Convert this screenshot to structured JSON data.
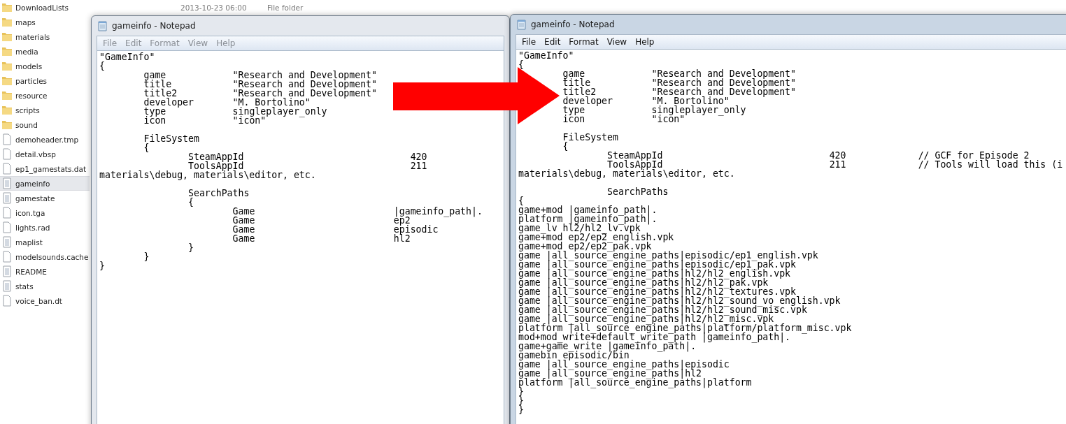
{
  "explorer": {
    "items": [
      {
        "name": "DownloadLists",
        "kind": "folder",
        "selected": false,
        "date": "2013-10-23 06:00",
        "type": "File folder"
      },
      {
        "name": "maps",
        "kind": "folder",
        "selected": false
      },
      {
        "name": "materials",
        "kind": "folder",
        "selected": false
      },
      {
        "name": "media",
        "kind": "folder",
        "selected": false
      },
      {
        "name": "models",
        "kind": "folder",
        "selected": false
      },
      {
        "name": "particles",
        "kind": "folder",
        "selected": false
      },
      {
        "name": "resource",
        "kind": "folder",
        "selected": false
      },
      {
        "name": "scripts",
        "kind": "folder",
        "selected": false
      },
      {
        "name": "sound",
        "kind": "folder",
        "selected": false
      },
      {
        "name": "demoheader.tmp",
        "kind": "file",
        "selected": false
      },
      {
        "name": "detail.vbsp",
        "kind": "file",
        "selected": false
      },
      {
        "name": "ep1_gamestats.dat",
        "kind": "file",
        "selected": false
      },
      {
        "name": "gameinfo",
        "kind": "text",
        "selected": true
      },
      {
        "name": "gamestate",
        "kind": "text",
        "selected": false
      },
      {
        "name": "icon.tga",
        "kind": "file",
        "selected": false
      },
      {
        "name": "lights.rad",
        "kind": "file",
        "selected": false
      },
      {
        "name": "maplist",
        "kind": "text",
        "selected": false
      },
      {
        "name": "modelsounds.cache",
        "kind": "file",
        "selected": false
      },
      {
        "name": "README",
        "kind": "text",
        "selected": false
      },
      {
        "name": "stats",
        "kind": "text",
        "selected": false
      },
      {
        "name": "voice_ban.dt",
        "kind": "file",
        "selected": false
      }
    ]
  },
  "windows": [
    {
      "title": "gameinfo - Notepad",
      "active": false,
      "menu": [
        "File",
        "Edit",
        "Format",
        "View",
        "Help"
      ],
      "lines": [
        {
          "text": "\"GameInfo\""
        },
        {
          "text": "{"
        },
        {
          "text": "\tgame\t\t\"Research and Development\""
        },
        {
          "text": "\ttitle\t\t\"Research and Development\""
        },
        {
          "text": "\ttitle2\t\t\"Research and Development\""
        },
        {
          "text": "\tdeveloper\t\"M. Bortolino\""
        },
        {
          "text": "\ttype\t\tsingleplayer_only"
        },
        {
          "text": "\ticon\t\t\"icon\""
        },
        {
          "text": "\tFileSystem",
          "blank_before": true
        },
        {
          "text": "\t{"
        },
        {
          "text": "\t\tSteamAppId\t\t\t\t420"
        },
        {
          "text": "\t\tToolsAppId\t\t\t\t211"
        },
        {
          "text": "materials\\debug, materials\\editor, etc."
        },
        {
          "text": "\t\tSearchPaths",
          "blank_before": true
        },
        {
          "text": "\t\t{"
        },
        {
          "text": "\t\t\tGame\t\t\t     |gameinfo_path|."
        },
        {
          "text": "\t\t\tGame\t\t\t     ep2"
        },
        {
          "text": "\t\t\tGame\t\t\t     episodic"
        },
        {
          "text": "\t\t\tGame\t\t\t     hl2"
        },
        {
          "text": "\t\t}"
        },
        {
          "text": "\t}"
        },
        {
          "text": "}"
        }
      ]
    },
    {
      "title": "gameinfo - Notepad",
      "active": true,
      "menu": [
        "File",
        "Edit",
        "Format",
        "View",
        "Help"
      ],
      "lines": [
        {
          "text": "\"GameInfo\""
        },
        {
          "text": "{"
        },
        {
          "text": "\tgame\t\t\"Research and Development\""
        },
        {
          "text": "\ttitle\t\t\"Research and Development\""
        },
        {
          "text": "\ttitle2\t\t\"Research and Development\""
        },
        {
          "text": "\tdeveloper\t\"M. Bortolino\""
        },
        {
          "text": "\ttype\t\tsingleplayer_only"
        },
        {
          "text": "\ticon\t\t\"icon\""
        },
        {
          "text": "\tFileSystem",
          "blank_before": true
        },
        {
          "text": "\t{"
        },
        {
          "text": "\t\tSteamAppId\t\t\t\t420\t\t// GCF for Episode 2"
        },
        {
          "text": "\t\tToolsAppId\t\t\t\t211\t\t// Tools will load this (i"
        },
        {
          "text": "materials\\debug, materials\\editor, etc."
        },
        {
          "text": "\t\tSearchPaths",
          "blank_before": true
        },
        {
          "text": "{"
        },
        {
          "text": "game+mod |gameinfo_path|."
        },
        {
          "text": "platform |gameinfo_path|."
        },
        {
          "text": "game_lv hl2/hl2_lv.vpk"
        },
        {
          "text": "game+mod ep2/ep2_english.vpk"
        },
        {
          "text": "game+mod ep2/ep2_pak.vpk"
        },
        {
          "text": "game |all_source_engine_paths|episodic/ep1_english.vpk"
        },
        {
          "text": "game |all_source_engine_paths|episodic/ep1_pak.vpk"
        },
        {
          "text": "game |all_source_engine_paths|hl2/hl2_english.vpk"
        },
        {
          "text": "game |all_source_engine_paths|hl2/hl2_pak.vpk"
        },
        {
          "text": "game |all_source_engine_paths|hl2/hl2_textures.vpk"
        },
        {
          "text": "game |all_source_engine_paths|hl2/hl2_sound_vo_english.vpk"
        },
        {
          "text": "game |all_source_engine_paths|hl2/hl2_sound_misc.vpk"
        },
        {
          "text": "game |all_source_engine_paths|hl2/hl2_misc.vpk"
        },
        {
          "text": "platform |all_source_engine_paths|platform/platform_misc.vpk"
        },
        {
          "text": "mod+mod_write+default_write_path |gameinfo_path|."
        },
        {
          "text": "game+game_write |gameinfo_path|."
        },
        {
          "text": "gamebin episodic/bin"
        },
        {
          "text": "game |all_source_engine_paths|episodic"
        },
        {
          "text": "game |all_source_engine_paths|hl2"
        },
        {
          "text": "platform |all_source_engine_paths|platform"
        },
        {
          "text": "}"
        },
        {
          "text": "}"
        },
        {
          "text": "}"
        }
      ]
    }
  ]
}
